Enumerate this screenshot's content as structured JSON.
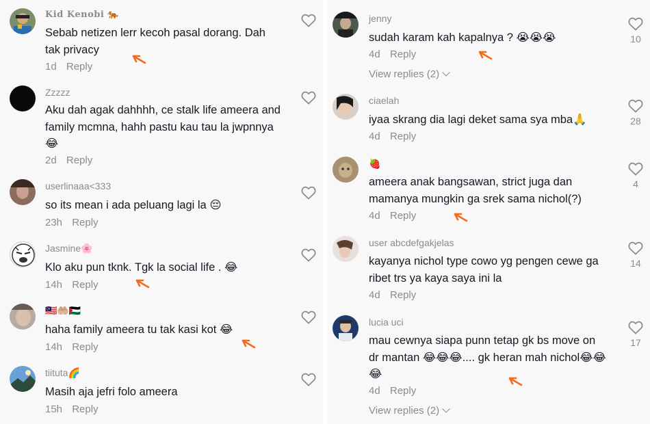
{
  "left_comments": [
    {
      "username": "Kid Kenobi 🐅",
      "text": "Sebab netizen lerr kecoh pasal dorang. Dah tak privacy",
      "time": "1d",
      "reply": "Reply"
    },
    {
      "username": "Zzzzz",
      "text": "Aku dah agak dahhhh, ce stalk life ameera and family mcmna, hahh pastu kau tau la jwpnnya 😂",
      "time": "2d",
      "reply": "Reply"
    },
    {
      "username": "userlinaaa<333",
      "text": "so its mean i ada peluang lagi la 😔",
      "time": "23h",
      "reply": "Reply"
    },
    {
      "username": "Jasmine🌸",
      "text": "Klo aku pun tknk. Tgk la social life . 😂",
      "time": "14h",
      "reply": "Reply"
    },
    {
      "username": "🇲🇾🤲🏼🇵🇸",
      "text": "haha family ameera tu tak kasi kot 😂",
      "time": "14h",
      "reply": "Reply"
    },
    {
      "username": "tiituta🌈",
      "text": "Masih aja jefri folo ameera",
      "time": "15h",
      "reply": "Reply"
    }
  ],
  "right_comments": [
    {
      "username": "jenny",
      "text": "sudah karam kah kapalnya ? 😭😭😭",
      "time": "4d",
      "reply": "Reply",
      "likes": "10",
      "view_replies": "View replies (2)"
    },
    {
      "username": "ciaelah",
      "text": "iyaa skrang dia lagi deket sama sya mba🙏",
      "time": "4d",
      "reply": "Reply",
      "likes": "28"
    },
    {
      "username": "🍓",
      "text": "ameera anak bangsawan, strict juga dan mamanya mungkin ga srek sama nichol(?)",
      "time": "4d",
      "reply": "Reply",
      "likes": "4"
    },
    {
      "username": "user abcdefgakjelas",
      "text": "kayanya nichol type cowo yg pengen cewe ga ribet trs ya kaya saya ini la",
      "time": "4d",
      "reply": "Reply",
      "likes": "14"
    },
    {
      "username": "lucia uci",
      "text": "mau cewnya siapa punn tetap gk bs move on dr mantan 😂😂😂.... gk heran mah nichol😂😂😂",
      "time": "4d",
      "reply": "Reply",
      "likes": "17",
      "view_replies": "View replies (2)"
    }
  ],
  "colors": {
    "arrow": "#f26b1d",
    "muted": "#8a8b91",
    "text": "#161823",
    "background": "#f8f8f8"
  },
  "icons": {
    "like": "heart-outline-icon",
    "expand": "chevron-down-icon"
  }
}
